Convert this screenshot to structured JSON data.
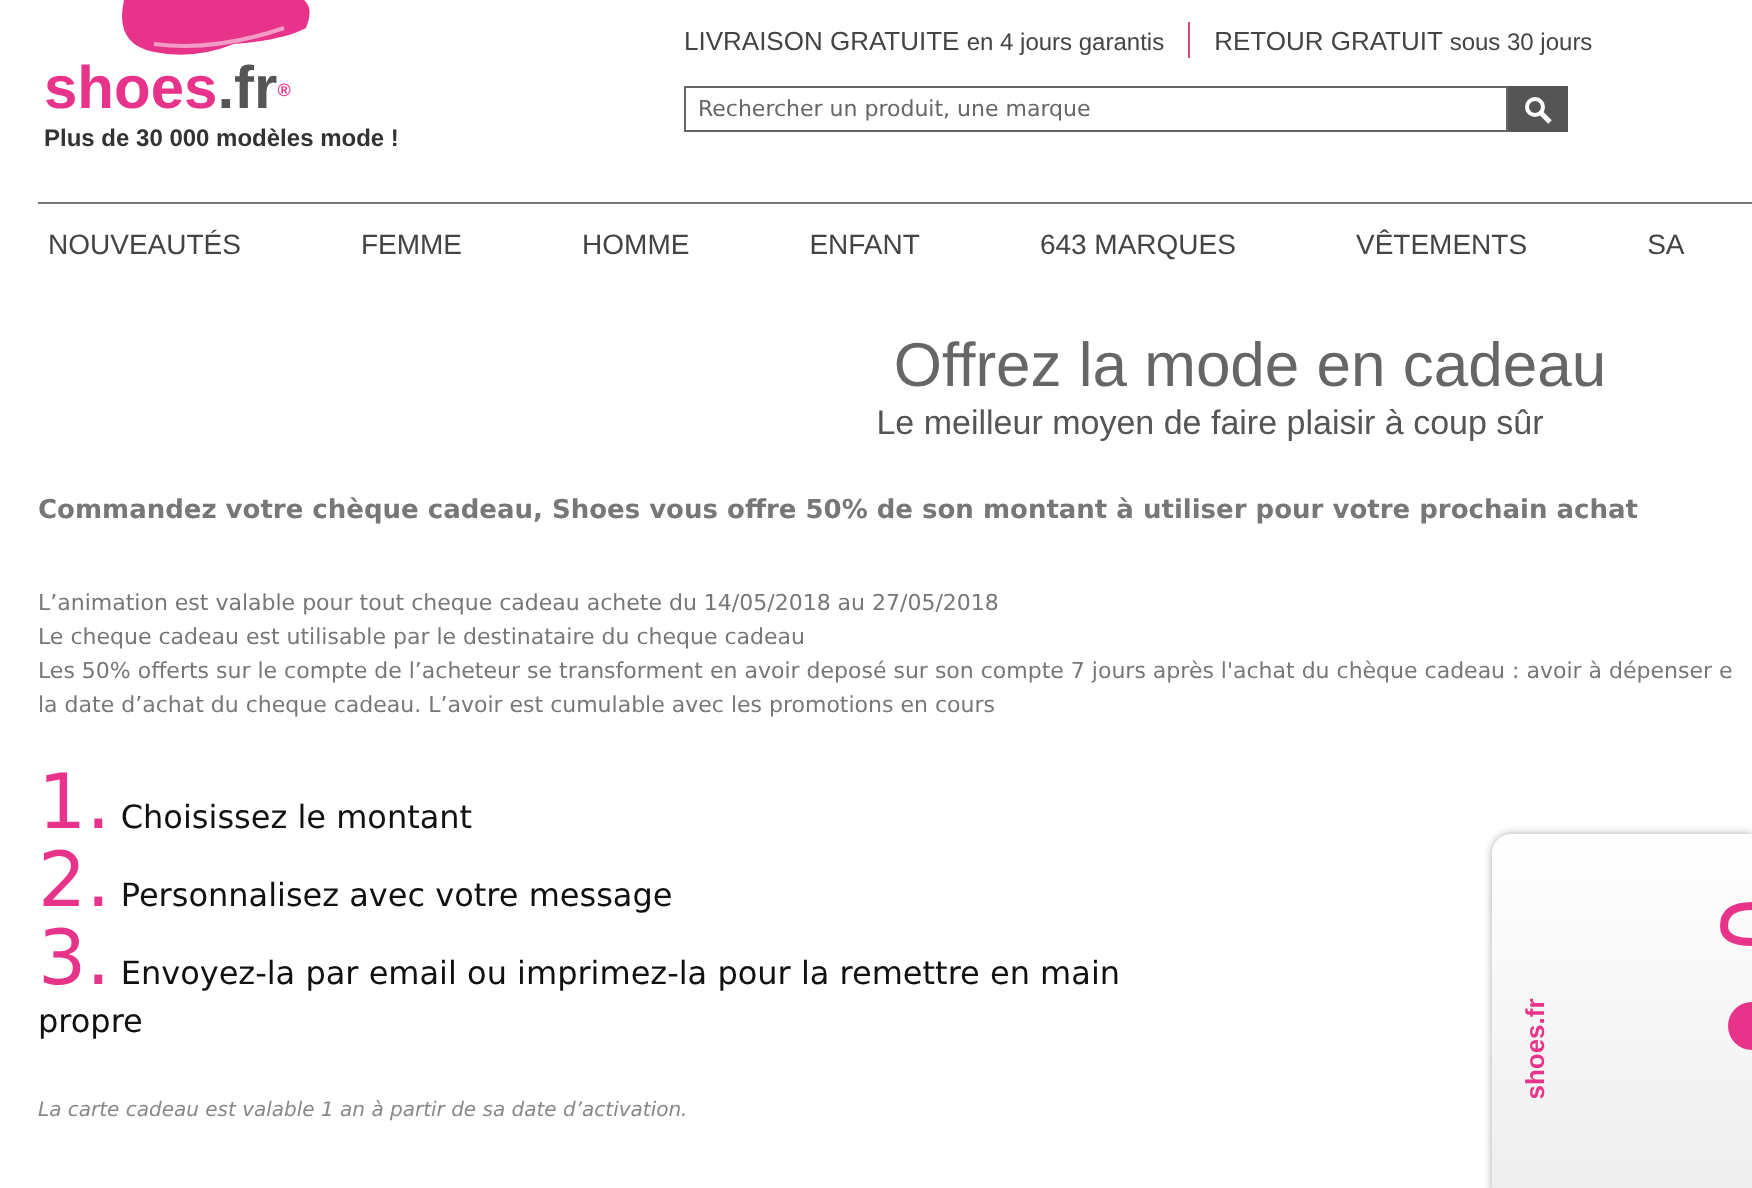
{
  "header": {
    "logo": {
      "brand": "shoes",
      "suffix": ".fr",
      "mark": "®"
    },
    "tagline": "Plus de 30 000 modèles mode !",
    "promises": [
      {
        "strong": "LIVRAISON GRATUITE",
        "rest": "en 4 jours garantis"
      },
      {
        "strong": "RETOUR GRATUIT",
        "rest": "sous 30 jours"
      }
    ],
    "search": {
      "placeholder": "Rechercher un produit, une marque"
    }
  },
  "nav": [
    "NOUVEAUTÉS",
    "FEMME",
    "HOMME",
    "ENFANT",
    "643 MARQUES",
    "VÊTEMENTS",
    "SA"
  ],
  "hero": {
    "title": "Offrez la mode en cadeau",
    "subtitle": "Le meilleur moyen de faire plaisir à coup sûr"
  },
  "offer": "Commandez votre chèque cadeau, Shoes vous offre 50% de son montant à utiliser pour votre prochain achat",
  "conditions": [
    "L’animation est valable pour tout cheque cadeau achete du 14/05/2018 au 27/05/2018",
    "Le cheque cadeau est utilisable par le destinataire du cheque cadeau",
    "Les 50% offerts sur le compte de l’acheteur se transforment en avoir deposé sur son compte 7 jours après l'achat du chèque cadeau : avoir à dépenser e",
    "la date d’achat du cheque cadeau. L’avoir est cumulable avec les promotions en cours"
  ],
  "steps": [
    {
      "number": "1.",
      "text": "Choisissez le montant"
    },
    {
      "number": "2.",
      "text": "Personnalisez avec votre message"
    },
    {
      "number": "3.",
      "text": "Envoyez-la par email ou imprimez-la pour la remettre en main propre"
    }
  ],
  "footnote": "La carte cadeau est valable 1 an à partir de sa date d’activation.",
  "card": {
    "logo": "shoes.fr"
  }
}
